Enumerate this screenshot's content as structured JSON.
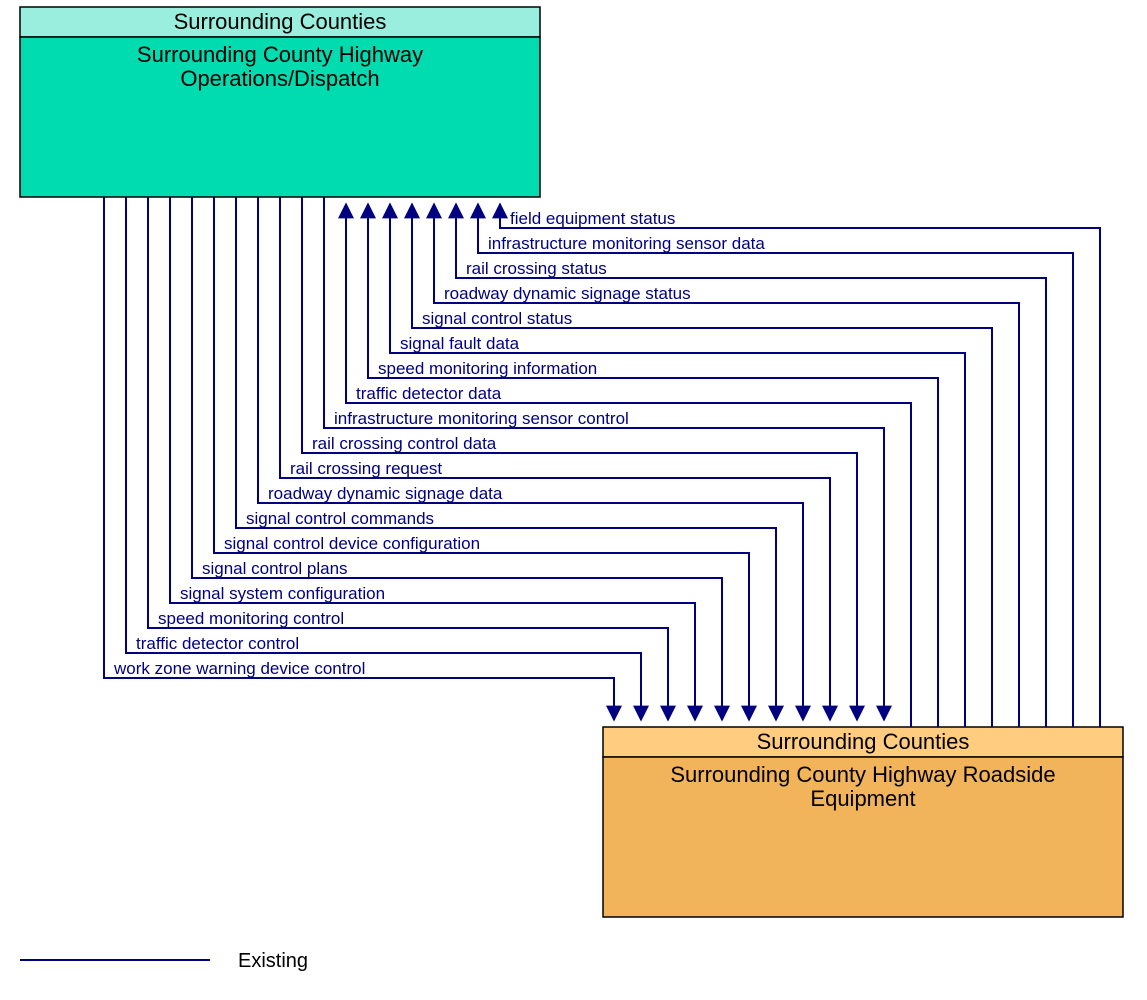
{
  "top_entity": {
    "header": "Surrounding Counties",
    "title1": "Surrounding County Highway",
    "title2": "Operations/Dispatch"
  },
  "bottom_entity": {
    "header": "Surrounding Counties",
    "title1": "Surrounding County Highway Roadside",
    "title2": "Equipment"
  },
  "to_top": [
    "field equipment status",
    "infrastructure monitoring sensor data",
    "rail crossing status",
    "roadway dynamic signage status",
    "signal control status",
    "signal fault data",
    "speed monitoring information",
    "traffic detector data"
  ],
  "to_bottom": [
    "infrastructure monitoring sensor control",
    "rail crossing control data",
    "rail crossing request",
    "roadway dynamic signage data",
    "signal control commands",
    "signal control device configuration",
    "signal control plans",
    "signal system configuration",
    "speed monitoring control",
    "traffic detector control",
    "work zone warning device control"
  ],
  "legend": "Existing",
  "colors": {
    "top_header": "#99eedd",
    "top_body": "#00dbb0",
    "bottom_header": "#ffcc80",
    "bottom_body": "#f2b45a",
    "line": "#000080",
    "border": "#000000"
  }
}
